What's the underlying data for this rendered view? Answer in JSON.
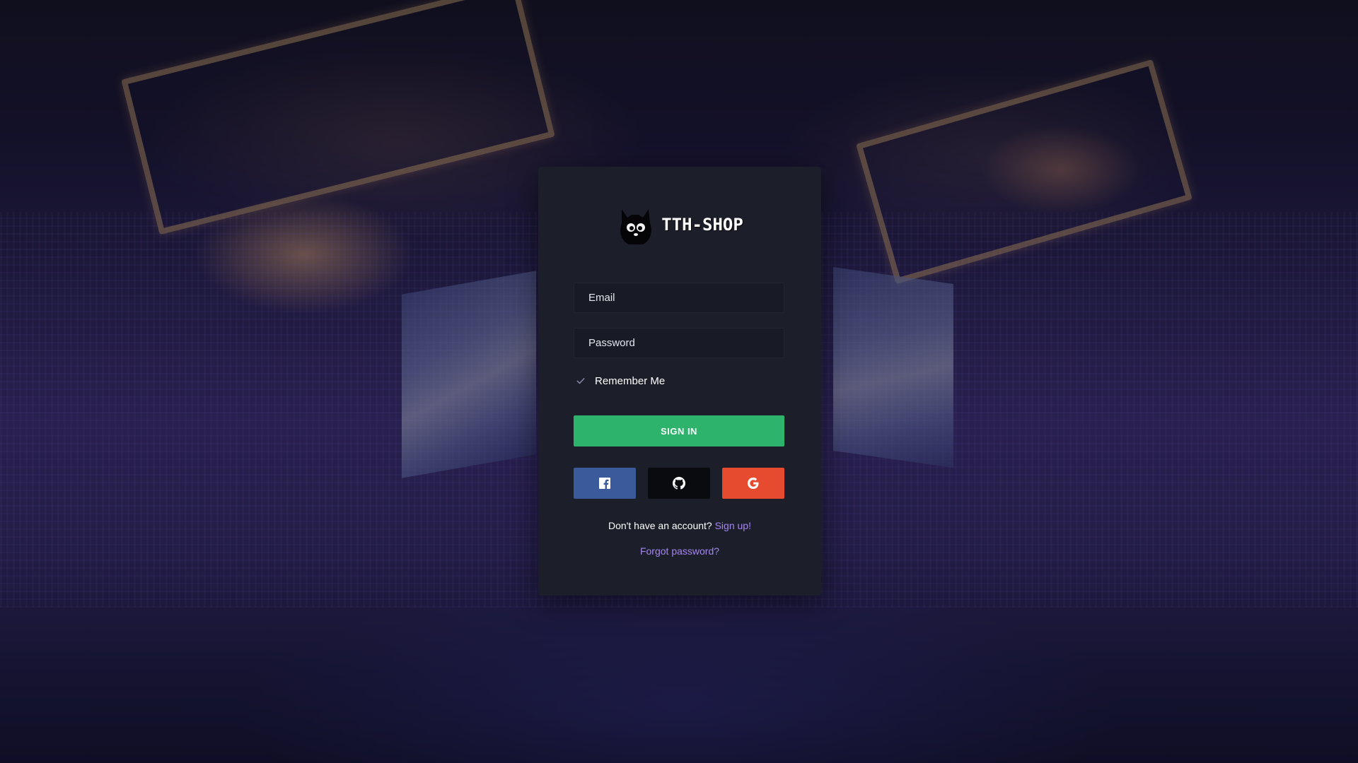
{
  "brand": {
    "name": "TTH-SHOP",
    "logo_icon": "cat-mascot-icon"
  },
  "form": {
    "email_placeholder": "Email",
    "email_value": "",
    "password_placeholder": "Password",
    "password_value": "",
    "remember_label": "Remember Me",
    "remember_checked": true,
    "signin_label": "SIGN IN"
  },
  "social": [
    {
      "name": "facebook",
      "icon": "facebook-icon",
      "color": "#3b5a9b"
    },
    {
      "name": "github",
      "icon": "github-icon",
      "color": "#0a0b0f"
    },
    {
      "name": "google",
      "icon": "google-icon",
      "color": "#e64a2f"
    }
  ],
  "footer": {
    "signup_prompt": "Don't have an account?",
    "signup_link": "Sign up!",
    "forgot_link": "Forgot password?"
  },
  "colors": {
    "card_bg": "#1c1f2a",
    "primary": "#2eb36c",
    "link": "#a486f0"
  }
}
